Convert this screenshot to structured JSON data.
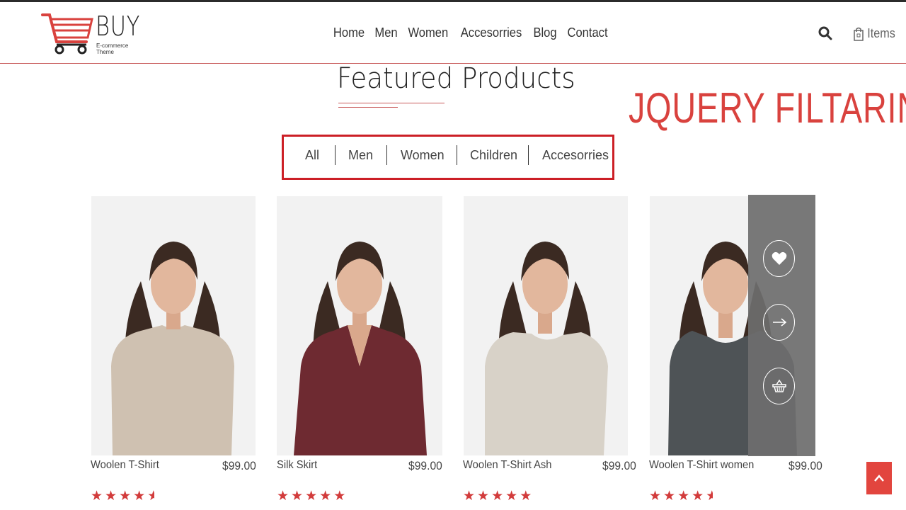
{
  "logo": {
    "word": "BUY",
    "tagline": "E-commerce Theme"
  },
  "nav": [
    "Home",
    "Men",
    "Women",
    "Accesorries",
    "Blog",
    "Contact"
  ],
  "header": {
    "items_label": "Items"
  },
  "section": {
    "title": "Featured Products"
  },
  "overlay": {
    "text": "JQUERY FILTARING"
  },
  "filters": [
    "All",
    "Men",
    "Women",
    "Children",
    "Accesorries"
  ],
  "products": [
    {
      "name": "Woolen T-Shirt",
      "price": "$99.00",
      "rating": 4.5,
      "garment_color": "#cfc1b1"
    },
    {
      "name": "Silk Skirt",
      "price": "$99.00",
      "rating": 5,
      "garment_color": "#6e2a31"
    },
    {
      "name": "Woolen T-Shirt Ash",
      "price": "$99.00",
      "rating": 5,
      "garment_color": "#d8d2c8"
    },
    {
      "name": "Woolen T-Shirt women",
      "price": "$99.00",
      "rating": 4.5,
      "garment_color": "#4e5356"
    }
  ],
  "colors": {
    "accent": "#d9423e",
    "filter_border": "#cc1f26",
    "hover_panel": "#6e6e6e"
  }
}
